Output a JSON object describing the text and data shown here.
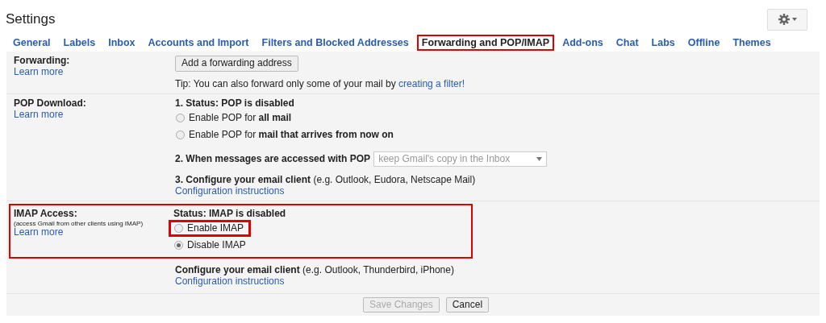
{
  "title": "Settings",
  "tabs": [
    {
      "label": "General",
      "selected": false,
      "highlighted": false
    },
    {
      "label": "Labels",
      "selected": false,
      "highlighted": false
    },
    {
      "label": "Inbox",
      "selected": false,
      "highlighted": false
    },
    {
      "label": "Accounts and Import",
      "selected": false,
      "highlighted": false
    },
    {
      "label": "Filters and Blocked Addresses",
      "selected": false,
      "highlighted": false
    },
    {
      "label": "Forwarding and POP/IMAP",
      "selected": true,
      "highlighted": true
    },
    {
      "label": "Add-ons",
      "selected": false,
      "highlighted": false
    },
    {
      "label": "Chat",
      "selected": false,
      "highlighted": false
    },
    {
      "label": "Labs",
      "selected": false,
      "highlighted": false
    },
    {
      "label": "Offline",
      "selected": false,
      "highlighted": false
    },
    {
      "label": "Themes",
      "selected": false,
      "highlighted": false
    }
  ],
  "forwarding": {
    "label": "Forwarding:",
    "learn_more": "Learn more",
    "button": "Add a forwarding address",
    "tip": "Tip: You can also forward only some of your mail by ",
    "tip_link": "creating a filter!"
  },
  "pop": {
    "label": "POP Download:",
    "learn_more": "Learn more",
    "status": "1. Status: POP is disabled",
    "options": [
      {
        "text": "Enable POP for **all mail**",
        "selected": false
      },
      {
        "text": "Enable POP for **mail that arrives from now on**",
        "selected": false
      }
    ],
    "step2": "2. When messages are accessed with POP",
    "select": {
      "value": "keep Gmail's copy in the Inbox",
      "disabled": true
    },
    "step3": "**3. Configure your email client** (e.g. Outlook, Eudora, Netscape Mail)",
    "link": "Configuration instructions"
  },
  "imap": {
    "label": "IMAP Access:",
    "note": "(access Gmail from other clients using IMAP)",
    "learn_more": "Learn more",
    "highlighted": true,
    "status": "Status: IMAP is disabled",
    "options": [
      {
        "text": "Enable IMAP",
        "selected": false,
        "highlighted": true
      },
      {
        "text": "Disable IMAP",
        "selected": true,
        "highlighted": false
      }
    ],
    "configure": "**Configure your email client** (e.g. Outlook, Thunderbird, iPhone)",
    "link": "Configuration instructions"
  },
  "buttons": [
    {
      "label": "Save Changes",
      "disabled": true
    },
    {
      "label": "Cancel",
      "disabled": false
    }
  ]
}
